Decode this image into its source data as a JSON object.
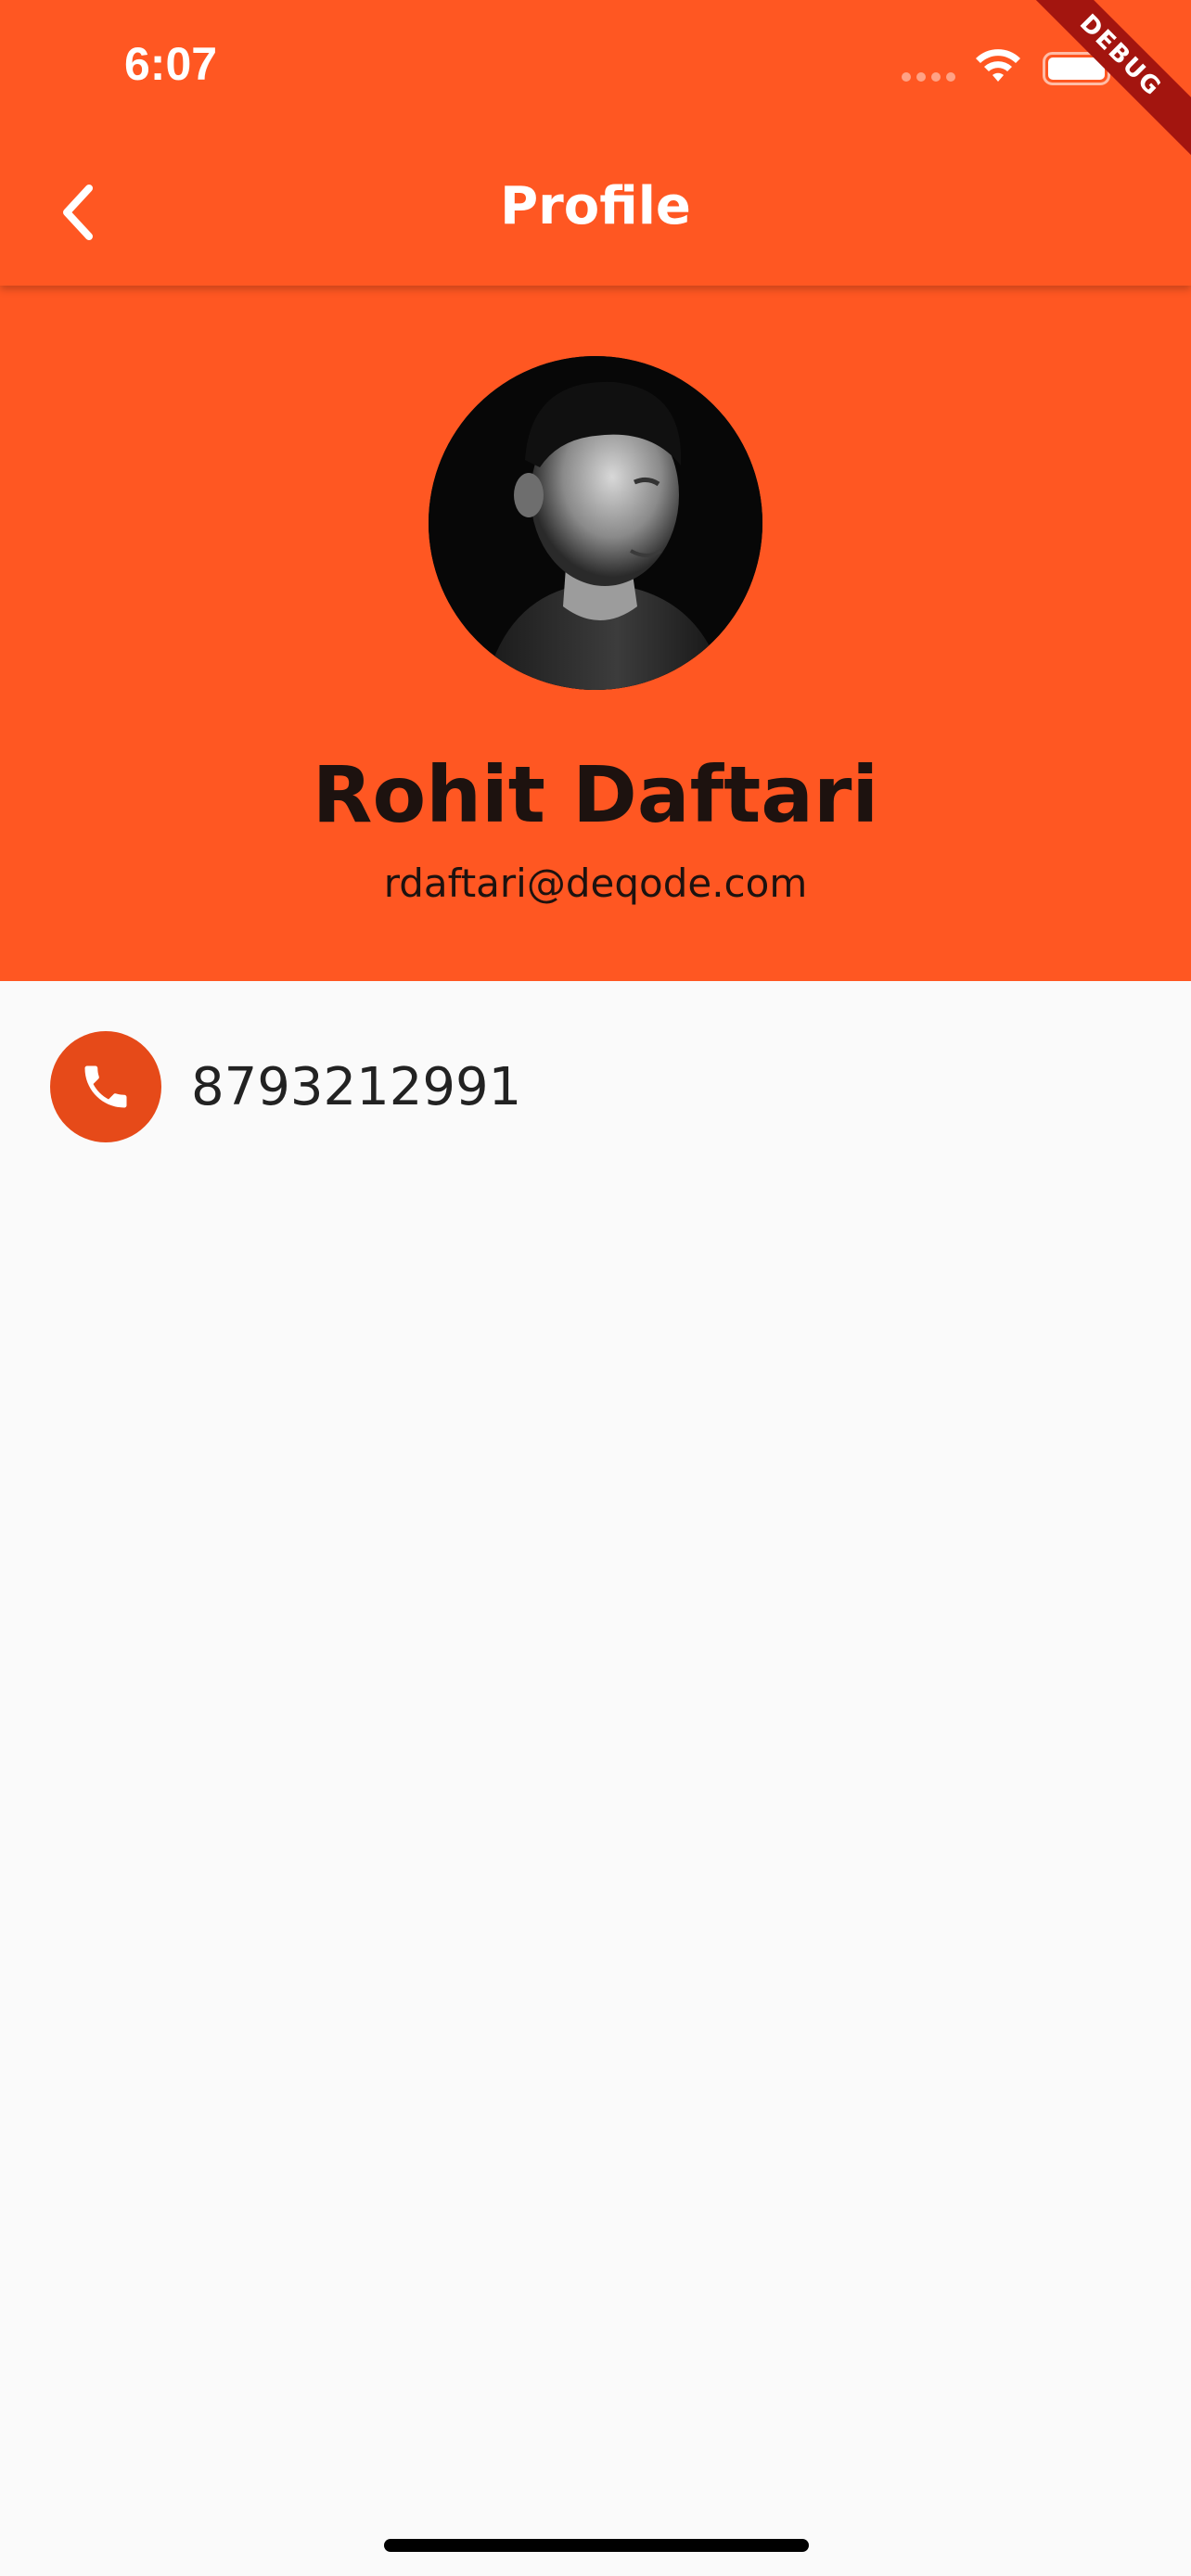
{
  "status_bar": {
    "time": "6:07",
    "signal_icon": "cellular-signal-icon",
    "wifi_icon": "wifi-icon",
    "battery_icon": "battery-icon"
  },
  "debug_banner": "DEBUG",
  "app_bar": {
    "title": "Profile",
    "back_icon": "chevron-left-icon"
  },
  "profile": {
    "avatar": "profile-photo",
    "name": "Rohit Daftari",
    "email": "rdaftari@deqode.com"
  },
  "contact": {
    "phone_icon": "phone-icon",
    "phone": "8793212991"
  },
  "colors": {
    "primary": "#ff5722",
    "phone_circle": "#e64a19",
    "background": "#fafafa",
    "name_text": "#1d120f",
    "debug_banner": "#a3150f"
  }
}
